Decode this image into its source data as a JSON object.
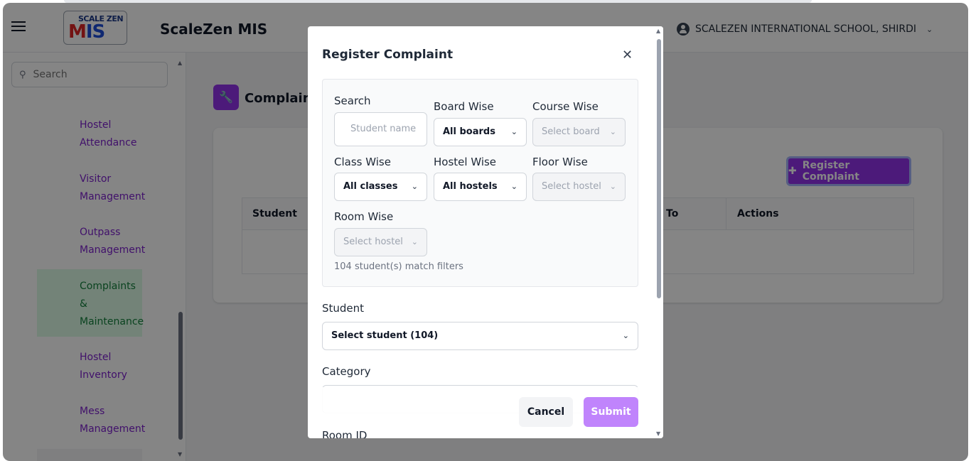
{
  "header": {
    "logo_top": "SCALE ZEN",
    "logo_main_m": "M",
    "logo_main_rest": "IS",
    "app_title": "ScaleZen MIS",
    "school_name": "SCALEZEN INTERNATIONAL SCHOOL, SHIRDI"
  },
  "sidebar": {
    "search_placeholder": "Search",
    "items": [
      {
        "label_1": "Hostel",
        "label_2": "Attendance"
      },
      {
        "label_1": "Visitor",
        "label_2": "Management"
      },
      {
        "label_1": "Outpass",
        "label_2": "Management"
      },
      {
        "label_1": "Complaints",
        "label_2": "&",
        "label_3": "Maintenance",
        "active": true
      },
      {
        "label_1": "Hostel",
        "label_2": "Inventory"
      },
      {
        "label_1": "Mess",
        "label_2": "Management"
      }
    ]
  },
  "main": {
    "page_title": "Complaints",
    "register_button": "Register Complaint",
    "table_headers": [
      "Student",
      "To",
      "Actions"
    ]
  },
  "modal": {
    "title": "Register Complaint",
    "filters": {
      "search_label": "Search",
      "search_placeholder": "Student name",
      "board_label": "Board Wise",
      "board_value": "All boards",
      "course_label": "Course Wise",
      "course_value": "Select board",
      "class_label": "Class Wise",
      "class_value": "All classes",
      "hostel_label": "Hostel Wise",
      "hostel_value": "All hostels",
      "floor_label": "Floor Wise",
      "floor_value": "Select hostel",
      "room_label": "Room Wise",
      "room_value": "Select hostel",
      "match_text": "104 student(s) match filters"
    },
    "student_label": "Student",
    "student_value": "Select student (104)",
    "category_label": "Category",
    "room_id_label": "Room ID",
    "cancel_label": "Cancel",
    "submit_label": "Submit"
  },
  "colors": {
    "brand_purple": "#9333ea",
    "submit_purple": "#c084fc",
    "nav_text": "#7e22ce",
    "active_nav_bg": "#dcfce7",
    "active_nav_text": "#15803d"
  }
}
